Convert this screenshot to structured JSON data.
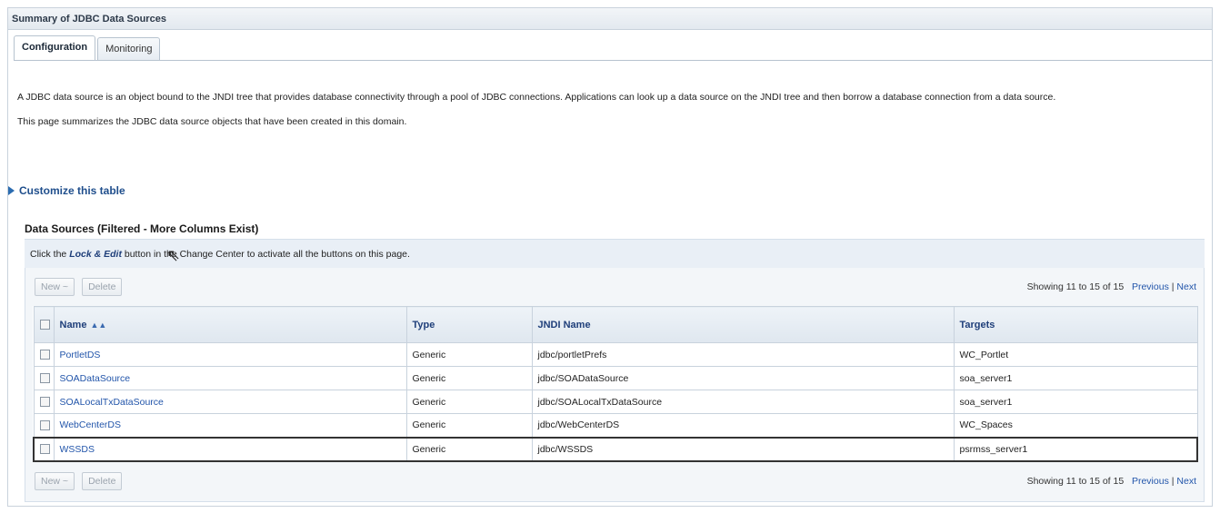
{
  "panel": {
    "title": "Summary of JDBC Data Sources"
  },
  "tabs": [
    {
      "label": "Configuration",
      "active": true
    },
    {
      "label": "Monitoring",
      "active": false
    }
  ],
  "description": {
    "p1": "A JDBC data source is an object bound to the JNDI tree that provides database connectivity through a pool of JDBC connections. Applications can look up a data source on the JNDI tree and then borrow a database connection from a data source.",
    "p2": "This page summarizes the JDBC data source objects that have been created in this domain."
  },
  "customize": {
    "label": "Customize this table"
  },
  "table": {
    "title": "Data Sources (Filtered - More Columns Exist)",
    "info_prefix": "Click the ",
    "info_lock": "Lock & Edit",
    "info_suffix": " button in the Change Center to activate all the buttons on this page.",
    "new_label": "New ~",
    "delete_label": "Delete",
    "pager": {
      "showing": "Showing 11 to 15 of 15",
      "previous": "Previous",
      "separator": "|",
      "next": "Next"
    },
    "columns": {
      "name": "Name",
      "type": "Type",
      "jndi": "JNDI Name",
      "targets": "Targets"
    },
    "rows": [
      {
        "name": "PortletDS",
        "type": "Generic",
        "jndi": "jdbc/portletPrefs",
        "targets": "WC_Portlet"
      },
      {
        "name": "SOADataSource",
        "type": "Generic",
        "jndi": "jdbc/SOADataSource",
        "targets": "soa_server1"
      },
      {
        "name": "SOALocalTxDataSource",
        "type": "Generic",
        "jndi": "jdbc/SOALocalTxDataSource",
        "targets": "soa_server1"
      },
      {
        "name": "WebCenterDS",
        "type": "Generic",
        "jndi": "jdbc/WebCenterDS",
        "targets": "WC_Spaces"
      },
      {
        "name": "WSSDS",
        "type": "Generic",
        "jndi": "jdbc/WSSDS",
        "targets": "psrmss_server1"
      }
    ]
  },
  "icons": {
    "customize_icon": "triangle-right",
    "sort_icon": "double-chevron-up",
    "cursor_icon": "mouse-pointer"
  },
  "colors": {
    "link": "#2255aa",
    "header_text": "#1f3f7a",
    "info_bar_bg": "#e9eff6"
  }
}
